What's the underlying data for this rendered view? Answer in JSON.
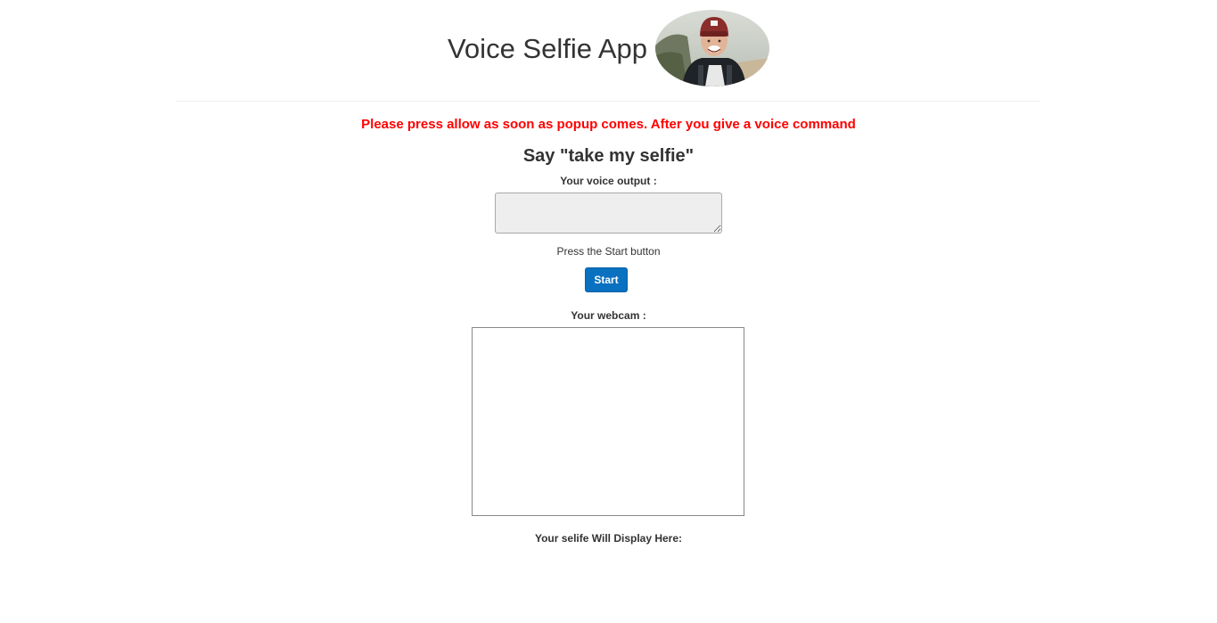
{
  "header": {
    "title": "Voice Selfie App",
    "avatar_icon": "avatar-photo"
  },
  "notice": {
    "text": "Please press allow as soon as popup comes. After you give a voice command",
    "color": "#ff0000"
  },
  "instruction": {
    "text": "Say \"take my selfie\""
  },
  "voice": {
    "label": "Your voice output :",
    "value": "",
    "placeholder": ""
  },
  "status": {
    "text": "Press the Start button"
  },
  "start_button": {
    "label": "Start",
    "color": "#0a70c0"
  },
  "webcam": {
    "label": "Your webcam :"
  },
  "selfie": {
    "label": "Your selife Will Display Here:"
  }
}
